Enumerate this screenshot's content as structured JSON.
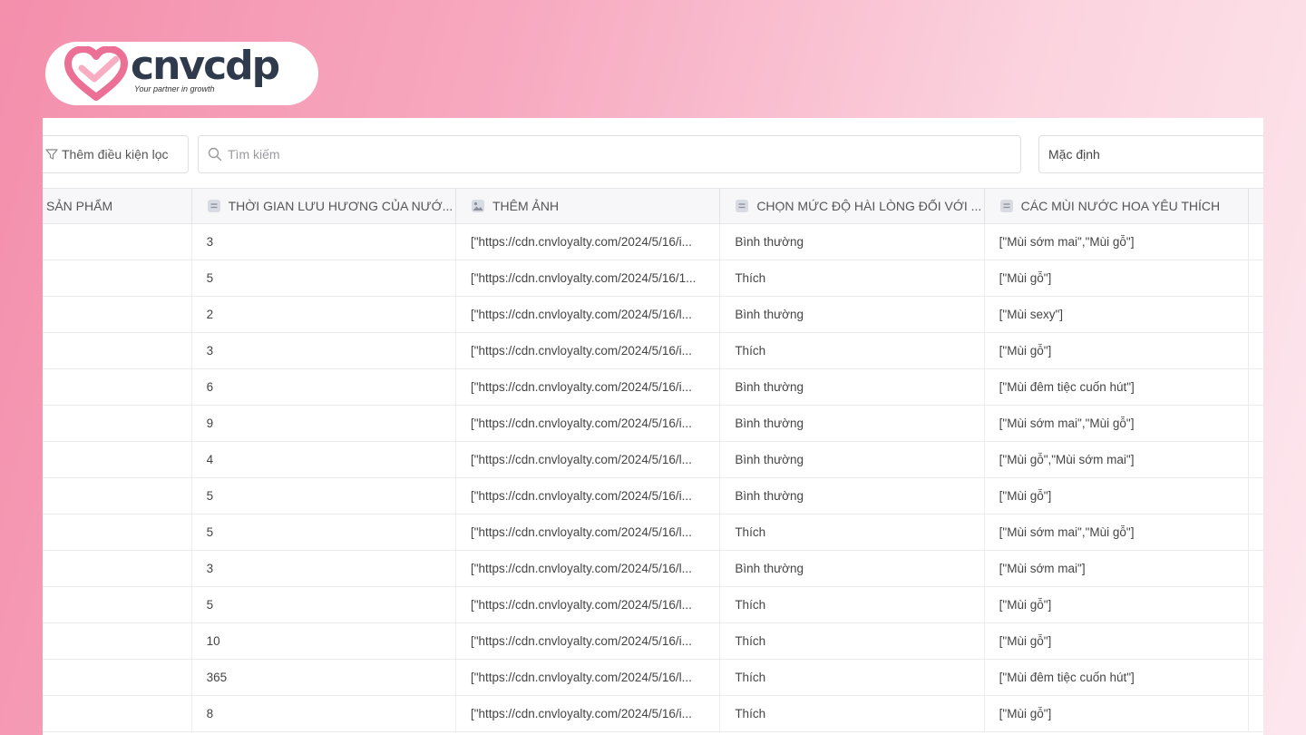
{
  "brand": {
    "name": "cnvcdp",
    "tagline": "Your partner in growth"
  },
  "toolbar": {
    "filter_label": "Thêm điều kiện lọc",
    "search_placeholder": "Tìm kiếm",
    "sort_value": "Mặc định"
  },
  "table": {
    "headers": [
      "SẢN PHẨM",
      "THỜI GIAN LƯU HƯƠNG CỦA NƯỚ...",
      "THÊM ẢNH",
      "CHỌN MỨC ĐỘ HÀI LÒNG ĐỐI VỚI ...",
      "CÁC MÙI NƯỚC HOA YÊU THÍCH"
    ],
    "rows": [
      {
        "product": "",
        "duration": "3",
        "image": "[\"https://cdn.cnvloyalty.com/2024/5/16/i...",
        "satisfaction": "Bình thường",
        "scents": "[\"Mùi sớm mai\",\"Mùi gỗ\"]"
      },
      {
        "product": "",
        "duration": "5",
        "image": "[\"https://cdn.cnvloyalty.com/2024/5/16/1...",
        "satisfaction": "Thích",
        "scents": "[\"Mùi gỗ\"]"
      },
      {
        "product": "",
        "duration": "2",
        "image": "[\"https://cdn.cnvloyalty.com/2024/5/16/l...",
        "satisfaction": "Bình thường",
        "scents": "[\"Mùi sexy\"]"
      },
      {
        "product": "",
        "duration": "3",
        "image": "[\"https://cdn.cnvloyalty.com/2024/5/16/i...",
        "satisfaction": "Thích",
        "scents": "[\"Mùi gỗ\"]"
      },
      {
        "product": "",
        "duration": "6",
        "image": "[\"https://cdn.cnvloyalty.com/2024/5/16/i...",
        "satisfaction": "Bình thường",
        "scents": "[\"Mùi đêm tiệc cuốn hút\"]"
      },
      {
        "product": "",
        "duration": "9",
        "image": "[\"https://cdn.cnvloyalty.com/2024/5/16/i...",
        "satisfaction": "Bình thường",
        "scents": "[\"Mùi sớm mai\",\"Mùi gỗ\"]"
      },
      {
        "product": "",
        "duration": "4",
        "image": "[\"https://cdn.cnvloyalty.com/2024/5/16/l...",
        "satisfaction": "Bình thường",
        "scents": "[\"Mùi gỗ\",\"Mùi sớm mai\"]"
      },
      {
        "product": "",
        "duration": "5",
        "image": "[\"https://cdn.cnvloyalty.com/2024/5/16/i...",
        "satisfaction": "Bình thường",
        "scents": "[\"Mùi gỗ\"]"
      },
      {
        "product": "",
        "duration": "5",
        "image": "[\"https://cdn.cnvloyalty.com/2024/5/16/l...",
        "satisfaction": "Thích",
        "scents": "[\"Mùi sớm mai\",\"Mùi gỗ\"]"
      },
      {
        "product": "",
        "duration": "3",
        "image": "[\"https://cdn.cnvloyalty.com/2024/5/16/l...",
        "satisfaction": "Bình thường",
        "scents": "[\"Mùi sớm mai\"]"
      },
      {
        "product": "",
        "duration": "5",
        "image": "[\"https://cdn.cnvloyalty.com/2024/5/16/l...",
        "satisfaction": "Thích",
        "scents": "[\"Mùi gỗ\"]"
      },
      {
        "product": "",
        "duration": "10",
        "image": "[\"https://cdn.cnvloyalty.com/2024/5/16/i...",
        "satisfaction": "Thích",
        "scents": "[\"Mùi gỗ\"]"
      },
      {
        "product": "",
        "duration": "365",
        "image": "[\"https://cdn.cnvloyalty.com/2024/5/16/l...",
        "satisfaction": "Thích",
        "scents": "[\"Mùi đêm tiệc cuốn hút\"]"
      },
      {
        "product": "",
        "duration": "8",
        "image": "[\"https://cdn.cnvloyalty.com/2024/5/16/i...",
        "satisfaction": "Thích",
        "scents": "[\"Mùi gỗ\"]"
      }
    ]
  },
  "icons": {
    "filter": "funnel-icon",
    "search": "magnifier-icon",
    "text_column": "text-field-icon",
    "image_column": "image-field-icon"
  },
  "colors": {
    "brand_pink": "#ec6f95",
    "brand_dark": "#2f3a4d"
  }
}
